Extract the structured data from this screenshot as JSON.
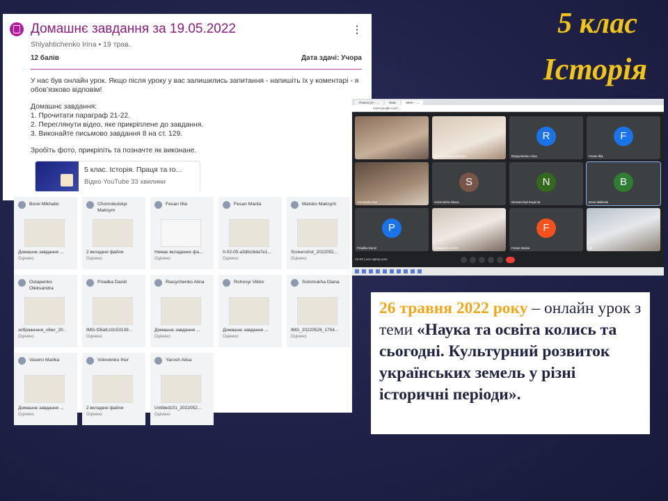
{
  "slide": {
    "title_line1": "5 клас",
    "title_line2": "Історія",
    "accent": "#f0c419"
  },
  "assignment": {
    "title": "Домашнє завдання за 19.05.2022",
    "menu": "⋮",
    "author": "Shlyahtichenko Irina • 19 трав.",
    "points": "12 балів",
    "due": "Дата здачі: Учора",
    "intro": "У нас був онлайн урок. Якщо після уроку у вас залишились запитання - напишіть їх у коментарі - я обов’язково відповім!",
    "hw_heading": "Домашнє завдання:",
    "hw_1": "1. Прочитати параграф 21-22.",
    "hw_2": "2. Переглянути відео, яке прикріплене до завдання.",
    "hw_3": "3. Виконайте письмово завдання 8 на ст. 129.",
    "outro": "Зробіть фото, прикріпіть та позначте як виконане.",
    "attachment_title": "5 клас. Історія. Праця та го...",
    "attachment_sub": "Відео YouTube  33 хвилини",
    "icon": "assignment-icon",
    "color": "#b5179e"
  },
  "submissions": [
    {
      "name": "Borei Mikhailo",
      "file": "Домашнє завдання ...",
      "status": "Оцінено"
    },
    {
      "name": "Chornokulskyi Maksym",
      "file": "2 вкладені файли",
      "status": "Оцінено"
    },
    {
      "name": "Fesan Illia",
      "file": "Немає вкладених фа...",
      "status": "Оцінено"
    },
    {
      "name": "Fesan Mariia",
      "file": "0-02-05-a3db16da7e1...",
      "status": "Оцінено"
    },
    {
      "name": "Matsko Maksym",
      "file": "Screenshot_2022052...",
      "status": "Оцінено"
    },
    {
      "name": "Ostapenko Oleksandra",
      "file": "зображення_viber_20...",
      "status": "Оцінено"
    },
    {
      "name": "Priadka Daniil",
      "file": "IMG-f26afc10c53139...",
      "status": "Оцінено"
    },
    {
      "name": "Riasychenko Alina",
      "file": "Домашнє завдання ...",
      "status": "Оцінено"
    },
    {
      "name": "Rohovyi Viktor",
      "file": "Домашнє завдання ...",
      "status": "Оцінено"
    },
    {
      "name": "Solomukha Diana",
      "file": "IMG_20220526_1754...",
      "status": "Оцінено"
    },
    {
      "name": "Vasero Marika",
      "file": "Домашнє завдання ...",
      "status": "Оцінено"
    },
    {
      "name": "Volovenko Ihor",
      "file": "2 вкладені файли",
      "status": "Оцінено"
    },
    {
      "name": "Yarosh Alisa",
      "file": "Untitled101_2022052...",
      "status": "Оцінено"
    }
  ],
  "meet": {
    "tabs": [
      "Пошта (1) – ...",
      "Клас",
      "Meet – ..."
    ],
    "url": "meet.google.com/...",
    "time": "10:03  |  acc-apmy-yxw",
    "tiles": [
      {
        "letter": "",
        "label": "",
        "kind": "vid"
      },
      {
        "letter": "",
        "label": "Chornokulskyi Maksym",
        "kind": "vid2"
      },
      {
        "letter": "R",
        "label": "Riasychenko Alina",
        "color": "#1a73e8"
      },
      {
        "letter": "F",
        "label": "Fesan Illia",
        "color": "#1a73e8"
      },
      {
        "letter": "",
        "label": "Volovenko Ihor",
        "kind": "vid3"
      },
      {
        "letter": "S",
        "label": "Solomukha Diana",
        "color": "#795548"
      },
      {
        "letter": "N",
        "label": "Nemanchyk Evgenia",
        "color": "#33691e"
      },
      {
        "letter": "B",
        "label": "Borei Mikhailo",
        "color": "#2e7d32"
      },
      {
        "letter": "P",
        "label": "Priadka Daniil",
        "color": "#1a73e8"
      },
      {
        "letter": "",
        "label": "Ostapenko Artem",
        "kind": "vid4"
      },
      {
        "letter": "F",
        "label": "Fesan Mariia",
        "color": "#f4511e"
      },
      {
        "letter": "",
        "label": "Ви",
        "kind": "vid5"
      }
    ]
  },
  "caption": {
    "date": "26 травня 2022 року",
    "dash": " – онлайн урок з теми ",
    "topic": "«Наука та освіта колись та сьогодні. Культурний розвиток українських земель у різні історичні періоди»."
  }
}
